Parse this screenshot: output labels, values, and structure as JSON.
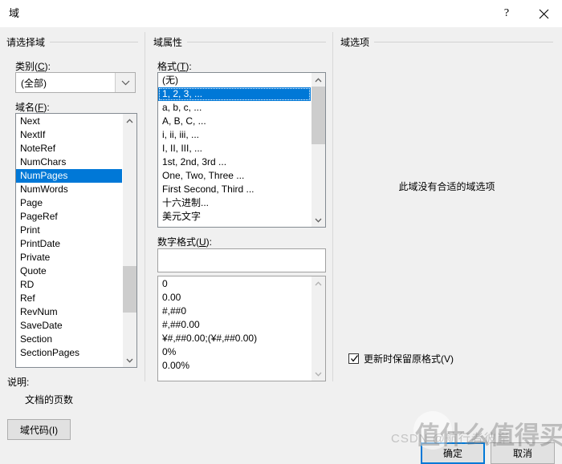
{
  "window": {
    "title": "域",
    "help_button": "?",
    "close_button": "✕"
  },
  "left_pane": {
    "group_title": "请选择域",
    "category_label_prefix": "类别(",
    "category_label_key": "C",
    "category_label_suffix": "):",
    "category_value": "(全部)",
    "fieldname_label_prefix": "域名(",
    "fieldname_label_key": "F",
    "fieldname_label_suffix": "):",
    "field_names": [
      "Next",
      "NextIf",
      "NoteRef",
      "NumChars",
      "NumPages",
      "NumWords",
      "Page",
      "PageRef",
      "Print",
      "PrintDate",
      "Private",
      "Quote",
      "RD",
      "Ref",
      "RevNum",
      "SaveDate",
      "Section",
      "SectionPages"
    ],
    "selected_field": "NumPages",
    "description_label": "说明:",
    "description_text": "文档的页数",
    "field_code_button": "域代码(I)"
  },
  "middle_pane": {
    "group_title": "域属性",
    "format_label_prefix": "格式(",
    "format_label_key": "T",
    "format_label_suffix": "):",
    "formats": [
      "(无)",
      "1, 2, 3, ...",
      "a, b, c, ...",
      "A, B, C, ...",
      "i, ii, iii, ...",
      "I, II, III, ...",
      "1st, 2nd, 3rd ...",
      "One, Two, Three ...",
      "First Second, Third ...",
      "十六进制...",
      "美元文字"
    ],
    "selected_format": "1, 2, 3, ...",
    "numformat_label_prefix": "数字格式(",
    "numformat_label_key": "U",
    "numformat_label_suffix": "):",
    "numformat_input_value": "",
    "number_formats": [
      "0",
      "0.00",
      "#,##0",
      "#,##0.00",
      "¥#,##0.00;(¥#,##0.00)",
      "0%",
      "0.00%"
    ]
  },
  "right_pane": {
    "group_title": "域选项",
    "empty_message": "此域没有合适的域选项",
    "preserve_format_checkbox": {
      "label": "更新时保留原格式(V)",
      "checked": true
    }
  },
  "footer": {
    "ok_button": "确定",
    "cancel_button": "取消"
  },
  "watermark": {
    "chinese_text": "值什么值得买",
    "latin_text": "CSDN @航行者彼岸"
  },
  "colors": {
    "accent": "#0078d7",
    "dialog_background": "#f0f0f0",
    "titlebar_background": "#ffffff",
    "list_background": "#ffffff",
    "scrollbar_thumb": "#cdcdcd",
    "border": "#848b92"
  }
}
